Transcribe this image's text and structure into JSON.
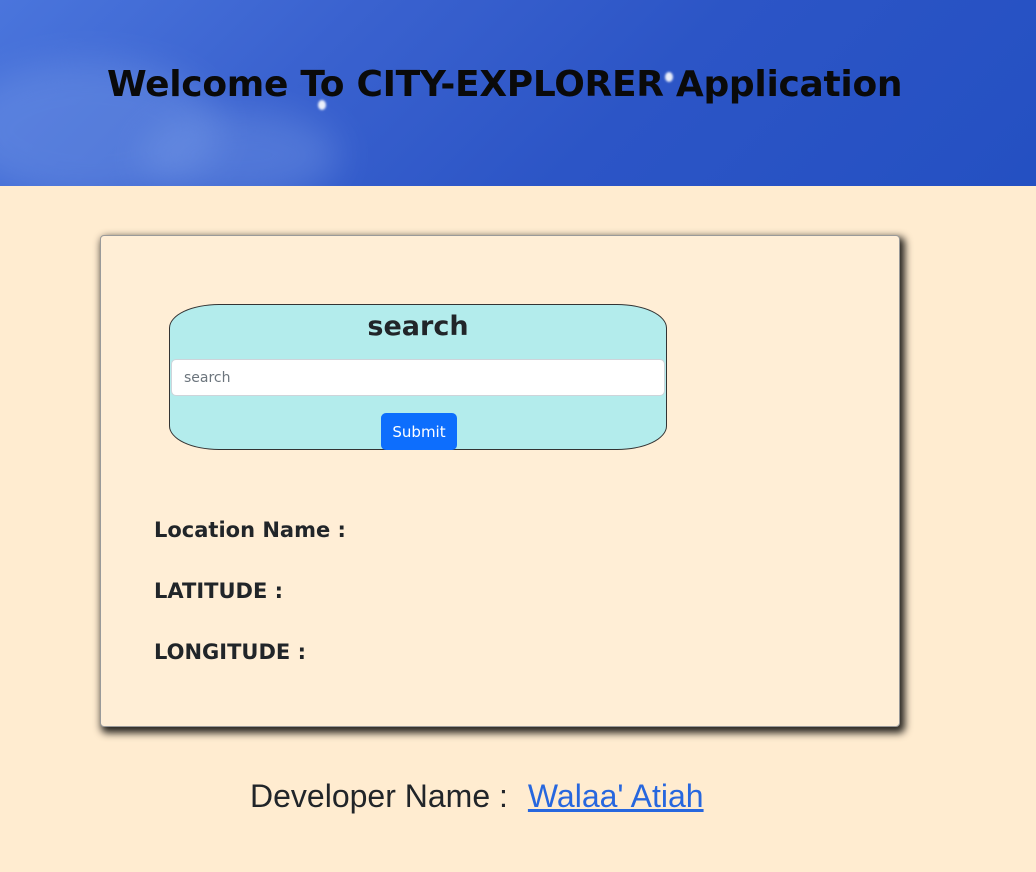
{
  "header": {
    "title": "Welcome To CITY-EXPLORER Application"
  },
  "search": {
    "heading": "search",
    "placeholder": "search",
    "value": "",
    "submit_label": "Submit"
  },
  "location": {
    "name_label": "Location Name :",
    "latitude_label": "LATITUDE :",
    "longitude_label": "LONGITUDE :"
  },
  "footer": {
    "developer_label": "Developer Name :",
    "developer_name": "Walaa' Atiah"
  },
  "colors": {
    "header_blue": "#2c55c6",
    "page_background": "#ffecd0",
    "search_box": "#b3ecec",
    "button_blue": "#0d6efd",
    "link_blue": "#2767de"
  }
}
